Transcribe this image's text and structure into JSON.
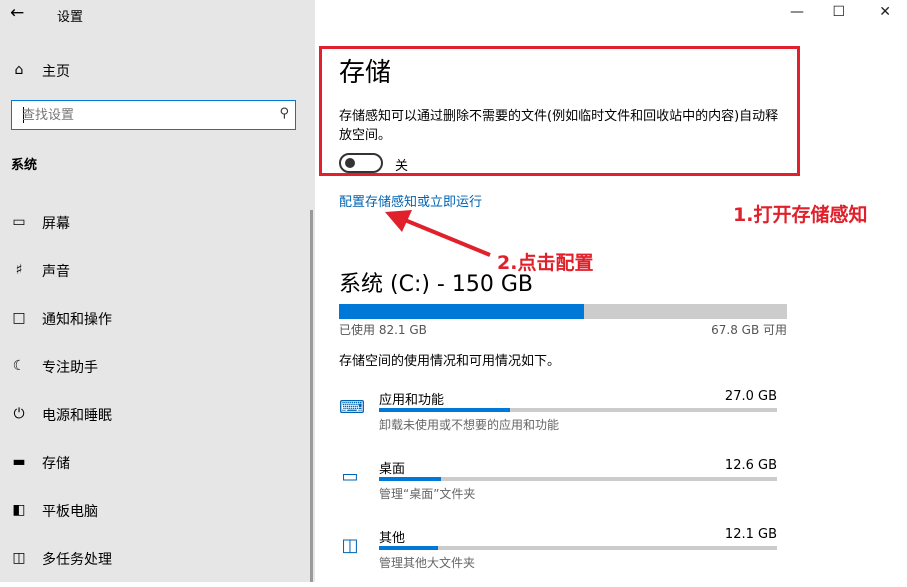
{
  "window": {
    "title": "设置",
    "minimize": "—",
    "maximize": "☐",
    "close": "✕"
  },
  "sidebar": {
    "home": "主页",
    "search_placeholder": "查找设置",
    "section": "系统",
    "items": [
      {
        "label": "屏幕",
        "icon": "display-icon"
      },
      {
        "label": "声音",
        "icon": "speaker-icon"
      },
      {
        "label": "通知和操作",
        "icon": "notification-icon"
      },
      {
        "label": "专注助手",
        "icon": "moon-icon"
      },
      {
        "label": "电源和睡眠",
        "icon": "power-icon"
      },
      {
        "label": "存储",
        "icon": "storage-icon"
      },
      {
        "label": "平板电脑",
        "icon": "tablet-icon"
      },
      {
        "label": "多任务处理",
        "icon": "multitask-icon"
      }
    ]
  },
  "main": {
    "title": "存储",
    "description": "存储感知可以通过删除不需要的文件(例如临时文件和回收站中的内容)自动释放空间。",
    "toggle_label": "关",
    "toggle_on": false,
    "config_link": "配置存储感知或立即运行",
    "drive_title": "系统 (C:) - 150 GB",
    "used_label": "已使用 82.1 GB",
    "free_label": "67.8 GB 可用",
    "used_fraction": 0.547,
    "overview": "存储空间的使用情况和可用情况如下。",
    "categories": [
      {
        "name": "应用和功能",
        "size": "27.0 GB",
        "desc": "卸载未使用或不想要的应用和功能",
        "fraction": 0.33,
        "icon": "apps-icon"
      },
      {
        "name": "桌面",
        "size": "12.6 GB",
        "desc": "管理“桌面”文件夹",
        "fraction": 0.155,
        "icon": "desktop-icon"
      },
      {
        "name": "其他",
        "size": "12.1 GB",
        "desc": "管理其他大文件夹",
        "fraction": 0.148,
        "icon": "folder-icon"
      }
    ]
  },
  "annotations": {
    "step1": "1.打开存储感知",
    "step2": "2.点击配置"
  },
  "colors": {
    "accent": "#0078d7",
    "annotation": "#e0202a",
    "link": "#0063b1"
  }
}
